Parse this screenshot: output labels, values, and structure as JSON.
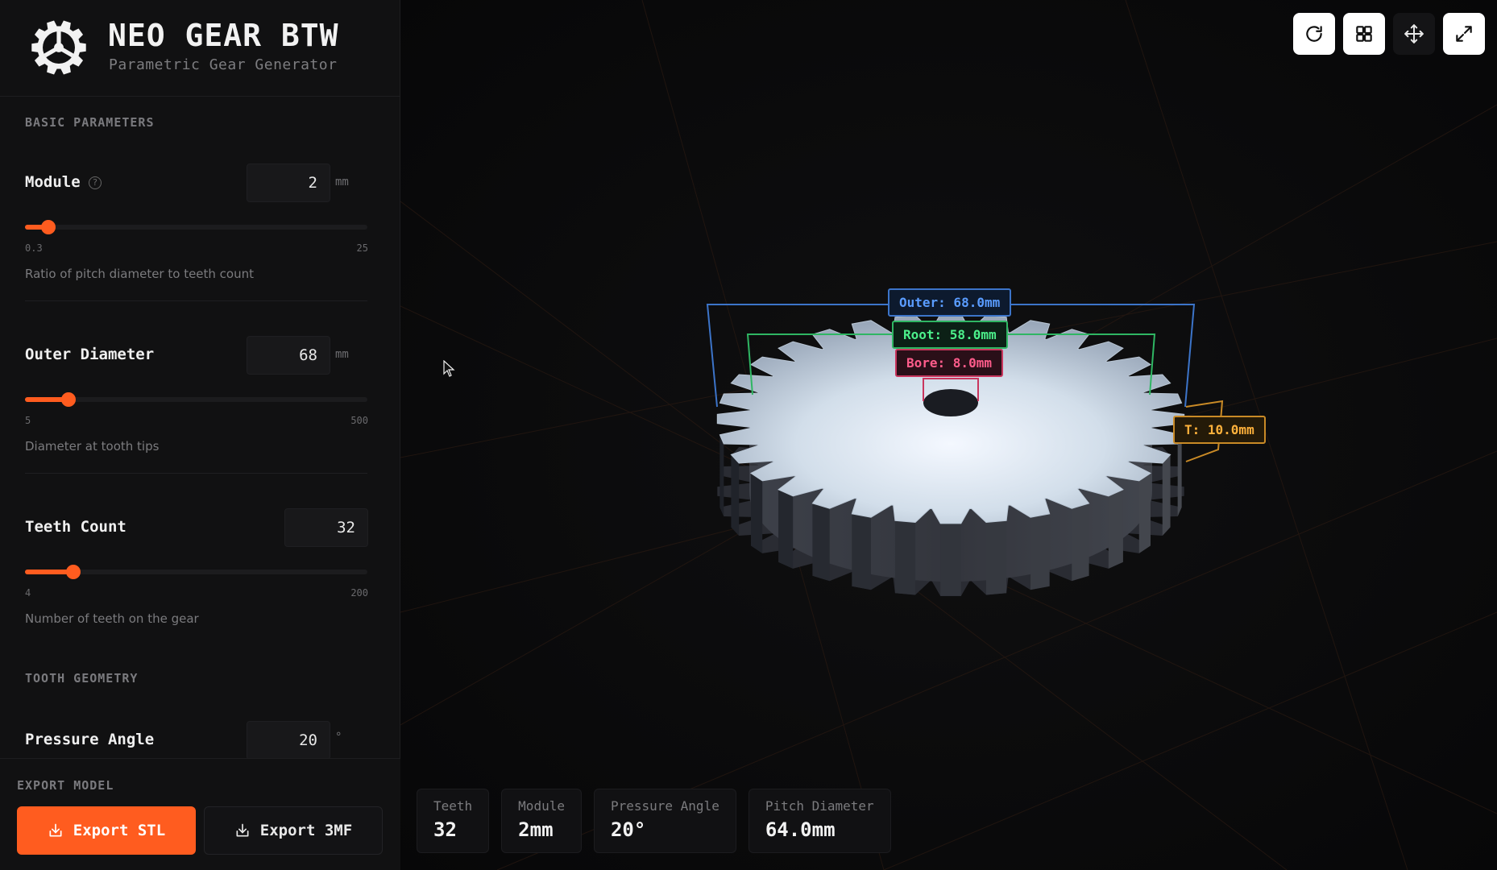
{
  "app": {
    "title": "NEO GEAR BTW",
    "subtitle": "Parametric Gear Generator",
    "logo_icon": "gear-logo-icon"
  },
  "basic_parameters": {
    "heading": "BASIC PARAMETERS",
    "module": {
      "label": "Module",
      "value": "2",
      "unit": "mm",
      "min": "0.3",
      "max": "25",
      "slider_fraction": 0.068,
      "description": "Ratio of pitch diameter to teeth count",
      "help_icon": "help-circle-icon"
    },
    "outer_diameter": {
      "label": "Outer Diameter",
      "value": "68",
      "unit": "mm",
      "min": "5",
      "max": "500",
      "slider_fraction": 0.127,
      "description": "Diameter at tooth tips"
    },
    "teeth_count": {
      "label": "Teeth Count",
      "value": "32",
      "min": "4",
      "max": "200",
      "slider_fraction": 0.14,
      "description": "Number of teeth on the gear"
    }
  },
  "tooth_geometry": {
    "heading": "TOOTH GEOMETRY",
    "pressure_angle": {
      "label": "Pressure Angle",
      "value": "20",
      "unit": "°"
    }
  },
  "export": {
    "heading": "EXPORT MODEL",
    "stl_label": "Export STL",
    "threemf_label": "Export 3MF",
    "icon": "download-icon"
  },
  "toolbar": {
    "buttons": [
      "reset-view-icon",
      "grid-icon",
      "move-icon",
      "fullscreen-icon"
    ]
  },
  "dimension_labels": {
    "outer": "Outer: 68.0mm",
    "root": "Root: 58.0mm",
    "bore": "Bore: 8.0mm",
    "thickness": "T: 10.0mm"
  },
  "stats": [
    {
      "label": "Teeth",
      "value": "32"
    },
    {
      "label": "Module",
      "value": "2mm"
    },
    {
      "label": "Pressure Angle",
      "value": "20°"
    },
    {
      "label": "Pitch Diameter",
      "value": "64.0mm"
    }
  ],
  "colors": {
    "accent": "#ff5c1f",
    "outer_dim": "#5a9cff",
    "root_dim": "#4cf08b",
    "bore_dim": "#ff5c8b",
    "thickness_dim": "#ffb13b"
  }
}
